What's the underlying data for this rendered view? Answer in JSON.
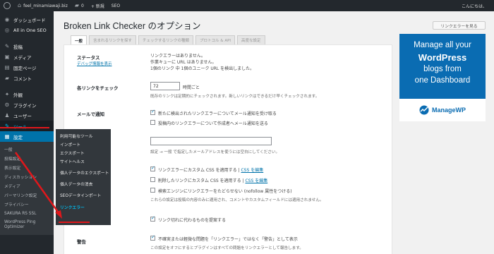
{
  "adminbar": {
    "site_name": "feel_minamiawaji.biz",
    "comments_count": "0",
    "new_label": "+ 新規",
    "seo_label": "SEO",
    "greeting": "こんにちは、"
  },
  "sidebar": {
    "items": [
      {
        "label": "ダッシュボード",
        "icon": "dashboard-icon",
        "glyph": "◉"
      },
      {
        "label": "All in One SEO",
        "icon": "seo-icon",
        "glyph": "◎"
      },
      {
        "label": "投稿",
        "icon": "pin-icon",
        "glyph": "✎"
      },
      {
        "label": "メディア",
        "icon": "media-icon",
        "glyph": "▣"
      },
      {
        "label": "固定ページ",
        "icon": "page-icon",
        "glyph": "▤"
      },
      {
        "label": "コメント",
        "icon": "comment-icon",
        "glyph": "▰"
      },
      {
        "label": "外観",
        "icon": "appearance-icon",
        "glyph": "✦"
      },
      {
        "label": "プラグイン",
        "icon": "plugin-icon",
        "glyph": "⚙"
      },
      {
        "label": "ユーザー",
        "icon": "user-icon",
        "glyph": "♟"
      },
      {
        "label": "ツール",
        "icon": "tools-icon",
        "glyph": "✎"
      },
      {
        "label": "設定",
        "icon": "settings-icon",
        "glyph": "▦"
      }
    ],
    "settings_submenu": [
      "一般",
      "投稿設定",
      "表示設定",
      "ディスカッション",
      "メディア",
      "パーマリンク設定",
      "プライバシー",
      "SAKURA RS SSL",
      "WordPress Ping Optimizer"
    ]
  },
  "flyout": {
    "items": [
      "利用可能なツール",
      "インポート",
      "エクスポート",
      "サイトヘルス",
      "個人データのエクスポート",
      "個人データの消去",
      "SEOデータインポート",
      "リンクエラー"
    ]
  },
  "page": {
    "title": "Broken Link Checker のオプション",
    "report_button": "リンクエラーを見る"
  },
  "tabs": [
    "一般",
    "含まれるリンクを探す",
    "チェックするリンクの種類",
    "プロトコル & API",
    "高度な設定"
  ],
  "settings": {
    "status_label": "ステータス",
    "debug_link": "デバッグ情報を表示",
    "status_lines": [
      "リンクエラーはありません。",
      "作業キューに URL はありません。",
      "1個のリンク 中 1個のユニーク URL を検出しました。"
    ],
    "check_each_label": "各リンクをチェック",
    "check_interval": "72",
    "interval_unit": "時間ごと",
    "interval_note": "既存のリンクは定期的にチェックされます。新しいリンクはできるだけ早くチェックされます。",
    "email_label": "メールで通知",
    "email_opt1": "新たに検出されたリンクエラーについてメール通知を受け取る",
    "email_opt2": "投稿内のリンクエラーについて作成者へメール通知を送る",
    "email_note": "設定 → 一般 で指定したメールアドレスを使うには空白にしてください。",
    "css_opt1": "リンクエラーにカスタム CSS を適用する |",
    "css_opt2": "削除したリンクにカスタム CSS を適用する |",
    "css_edit": "CSS を編集",
    "nofollow_opt": "検索エンジンにリンクエラーをたどらせない (nofollow 属性をつける)",
    "nofollow_note": "これらの設定は投稿の内容のみに適用され、コメントやカスタムフィールドには適用されません。",
    "suggest_opt": "リンク切れに代わるものを提案する",
    "warning_label": "警告",
    "warning_opt": "不確実または軽微な問題を「リンクエラー」ではなく「警告」として表示",
    "warning_note": "この設定をオフにするとプラグインはすべての問題をリンクエラーとして報告します。"
  },
  "ad": {
    "lines": [
      "Manage all your",
      "WordPress",
      "blogs from",
      "one Dashboard"
    ],
    "logo_text": "ManageWP"
  },
  "colors": {
    "accent": "#0073aa",
    "annotation": "#e0171b",
    "sidebar": "#23282d"
  }
}
